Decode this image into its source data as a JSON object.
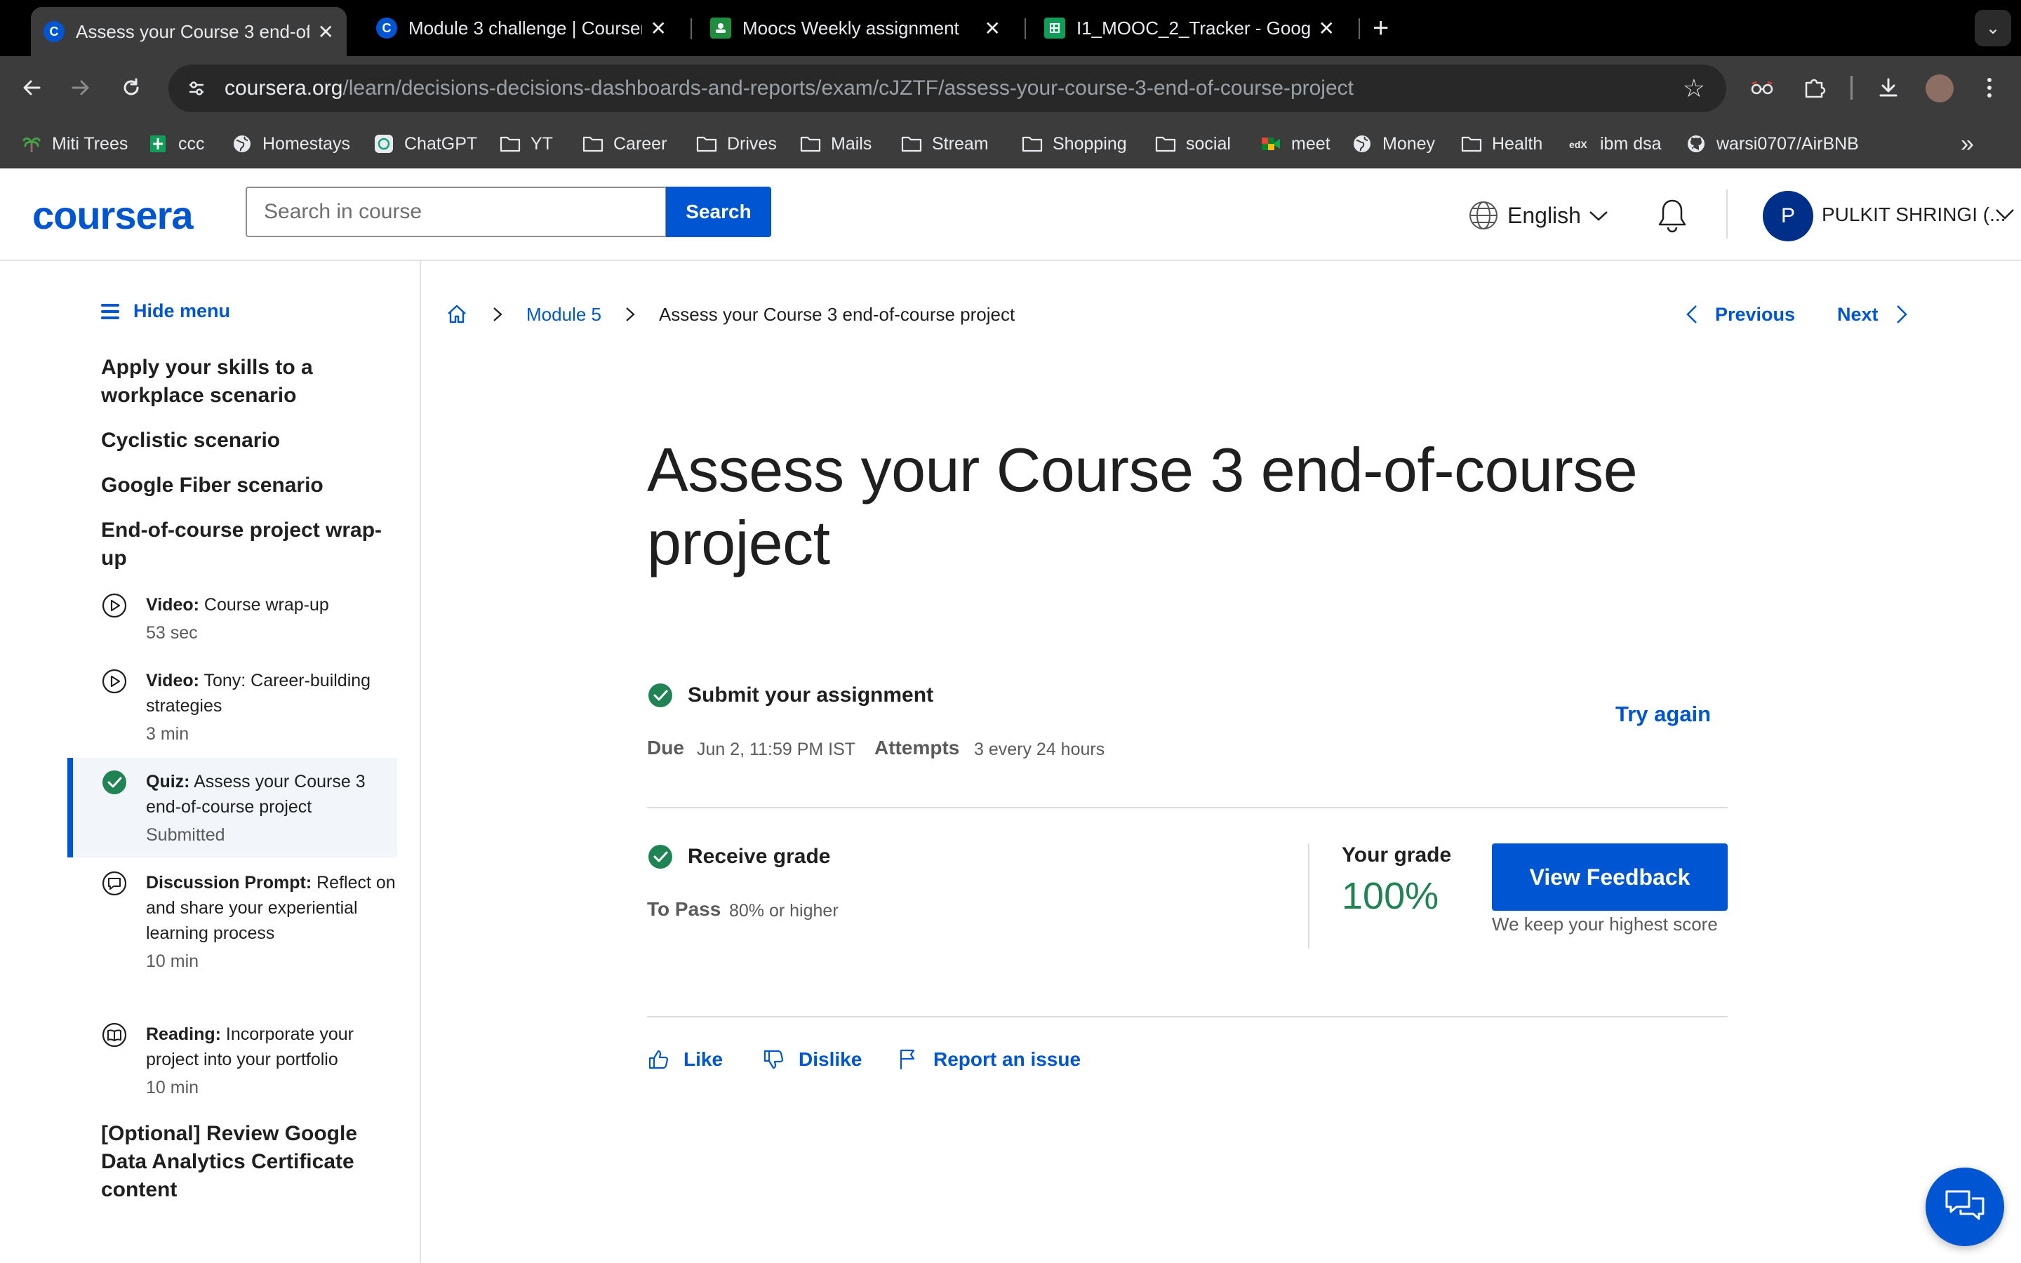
{
  "browser": {
    "tabs": [
      {
        "title": "Assess your Course 3 end-of",
        "icon": "coursera-favicon"
      },
      {
        "title": "Module 3 challenge | Coursera",
        "icon": "coursera-favicon"
      },
      {
        "title": "Moocs Weekly assignment",
        "icon": "classroom-favicon"
      },
      {
        "title": "I1_MOOC_2_Tracker - Google",
        "icon": "sheets-favicon"
      }
    ],
    "url_domain": "coursera.org",
    "url_path": "/learn/decisions-decisions-dashboards-and-reports/exam/cJZTF/assess-your-course-3-end-of-course-project",
    "bookmarks": [
      {
        "label": "Miti Trees",
        "icon": "palm-icon"
      },
      {
        "label": "ccc",
        "icon": "sheets-icon"
      },
      {
        "label": "Homestays",
        "icon": "globe-icon"
      },
      {
        "label": "ChatGPT",
        "icon": "chatgpt-icon"
      },
      {
        "label": "YT",
        "icon": "folder-icon"
      },
      {
        "label": "Career",
        "icon": "folder-icon"
      },
      {
        "label": "Drives",
        "icon": "folder-icon"
      },
      {
        "label": "Mails",
        "icon": "folder-icon"
      },
      {
        "label": "Stream",
        "icon": "folder-icon"
      },
      {
        "label": "Shopping",
        "icon": "folder-icon"
      },
      {
        "label": "social",
        "icon": "folder-icon"
      },
      {
        "label": "meet",
        "icon": "meet-icon"
      },
      {
        "label": "Money",
        "icon": "globe-icon"
      },
      {
        "label": "Health",
        "icon": "folder-icon"
      },
      {
        "label": "ibm dsa",
        "icon": "edx-icon"
      },
      {
        "label": "warsi0707/AirBNB",
        "icon": "github-icon"
      }
    ]
  },
  "header": {
    "logo": "coursera",
    "search_placeholder": "Search in course",
    "search_button": "Search",
    "language": "English",
    "user_initial": "P",
    "user_name": "PULKIT SHRINGI (..."
  },
  "sidebar": {
    "hide_menu": "Hide menu",
    "sections": [
      "Apply your skills to a workplace scenario",
      "Cyclistic scenario",
      "Google Fiber scenario",
      "End-of-course project wrap-up"
    ],
    "items": [
      {
        "type": "Video:",
        "title": "Course wrap-up",
        "meta": "53 sec"
      },
      {
        "type": "Video:",
        "title": "Tony: Career-building strategies",
        "meta": "3 min"
      },
      {
        "type": "Quiz:",
        "title": "Assess your Course 3 end-of-course project",
        "meta": "Submitted"
      },
      {
        "type": "Discussion Prompt:",
        "title": "Reflect on and share your experiential learning process",
        "meta": "10 min"
      },
      {
        "type": "Reading:",
        "title": "Incorporate your project into your portfolio",
        "meta": "10 min"
      }
    ],
    "optional_section": "[Optional] Review Google Data Analytics Certificate content"
  },
  "main": {
    "breadcrumb": {
      "module": "Module 5",
      "current": "Assess your Course 3 end-of-course project"
    },
    "prev": "Previous",
    "next": "Next",
    "title": "Assess your Course 3 end-of-course project",
    "submit": {
      "title": "Submit your assignment",
      "due_label": "Due",
      "due_value": "Jun 2, 11:59 PM IST",
      "attempts_label": "Attempts",
      "attempts_value": "3 every 24 hours",
      "try_again": "Try again"
    },
    "grade": {
      "title": "Receive grade",
      "to_pass_label": "To Pass",
      "to_pass_value": "80% or higher",
      "your_grade_label": "Your grade",
      "your_grade_value": "100%",
      "view_feedback": "View Feedback",
      "keep_note": "We keep your highest score"
    },
    "feedback": {
      "like": "Like",
      "dislike": "Dislike",
      "report": "Report an issue"
    }
  },
  "colors": {
    "brand": "#0056d2",
    "success": "#1f8354"
  }
}
